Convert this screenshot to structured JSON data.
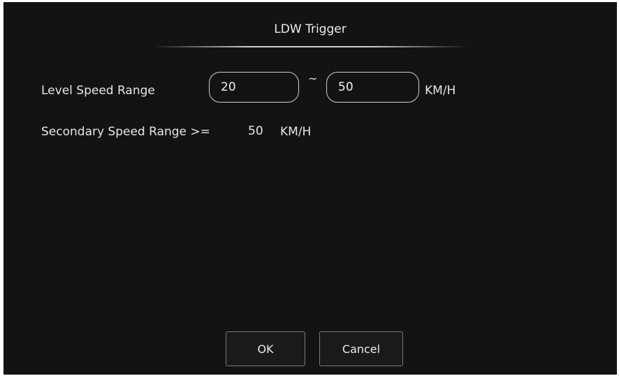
{
  "dialog": {
    "title": "LDW Trigger"
  },
  "level_speed": {
    "label": "Level Speed Range",
    "min_value": "20",
    "separator": "~",
    "max_value": "50",
    "unit": "KM/H"
  },
  "secondary_speed": {
    "label": "Secondary Speed Range >=",
    "value": "50",
    "unit": "KM/H"
  },
  "buttons": {
    "ok_label": "OK",
    "cancel_label": "Cancel"
  },
  "colors": {
    "background": "#131313",
    "text": "#e6e6e6",
    "field_border": "#cfcfcf",
    "button_border": "#7a7a7a"
  }
}
